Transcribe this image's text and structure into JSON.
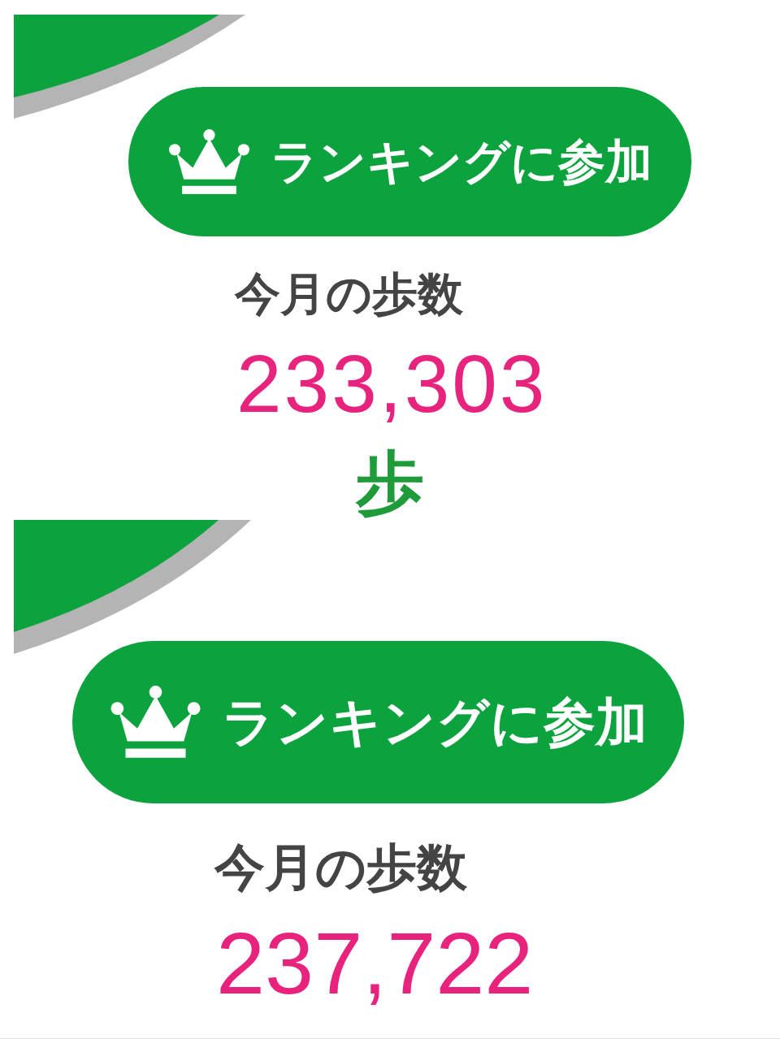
{
  "panels": [
    {
      "button": {
        "label": "ランキングに参加"
      },
      "label": "今月の歩数",
      "steps": "233,303",
      "unit": "歩"
    },
    {
      "button": {
        "label": "ランキングに参加"
      },
      "label": "今月の歩数",
      "steps": "237,722"
    }
  ]
}
